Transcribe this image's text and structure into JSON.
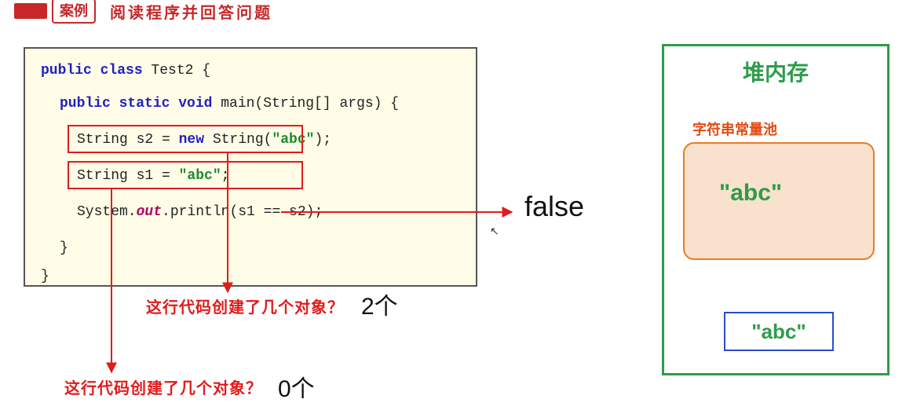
{
  "title": {
    "badge": "案例",
    "rest": "阅读程序并回答问题"
  },
  "code": {
    "l1_public_class": "public class",
    "l1_name": " Test2 {",
    "l2_psv": "public static void",
    "l2_main": " main(String[] args) {",
    "l3_lead": "String s2 = ",
    "l3_new": "new",
    "l3_mid": " String(",
    "l3_str": "\"abc\"",
    "l3_end": ");",
    "l4_lead": "String s1 = ",
    "l4_str": "\"abc\"",
    "l4_end": ";",
    "l5_lead": "System.",
    "l5_out": "out",
    "l5_rest": ".println(s1 == s2);",
    "brace_close_inner": "}",
    "brace_close_outer": "}"
  },
  "result": {
    "false": "false"
  },
  "question1": {
    "text": "这行代码创建了几个对象？",
    "answer": "2个"
  },
  "question2": {
    "text": "这行代码创建了几个对象？",
    "answer": "0个"
  },
  "heap": {
    "title": "堆内存",
    "pool_label": "字符串常量池",
    "pool_value": "\"abc\"",
    "obj_value": "\"abc\""
  }
}
